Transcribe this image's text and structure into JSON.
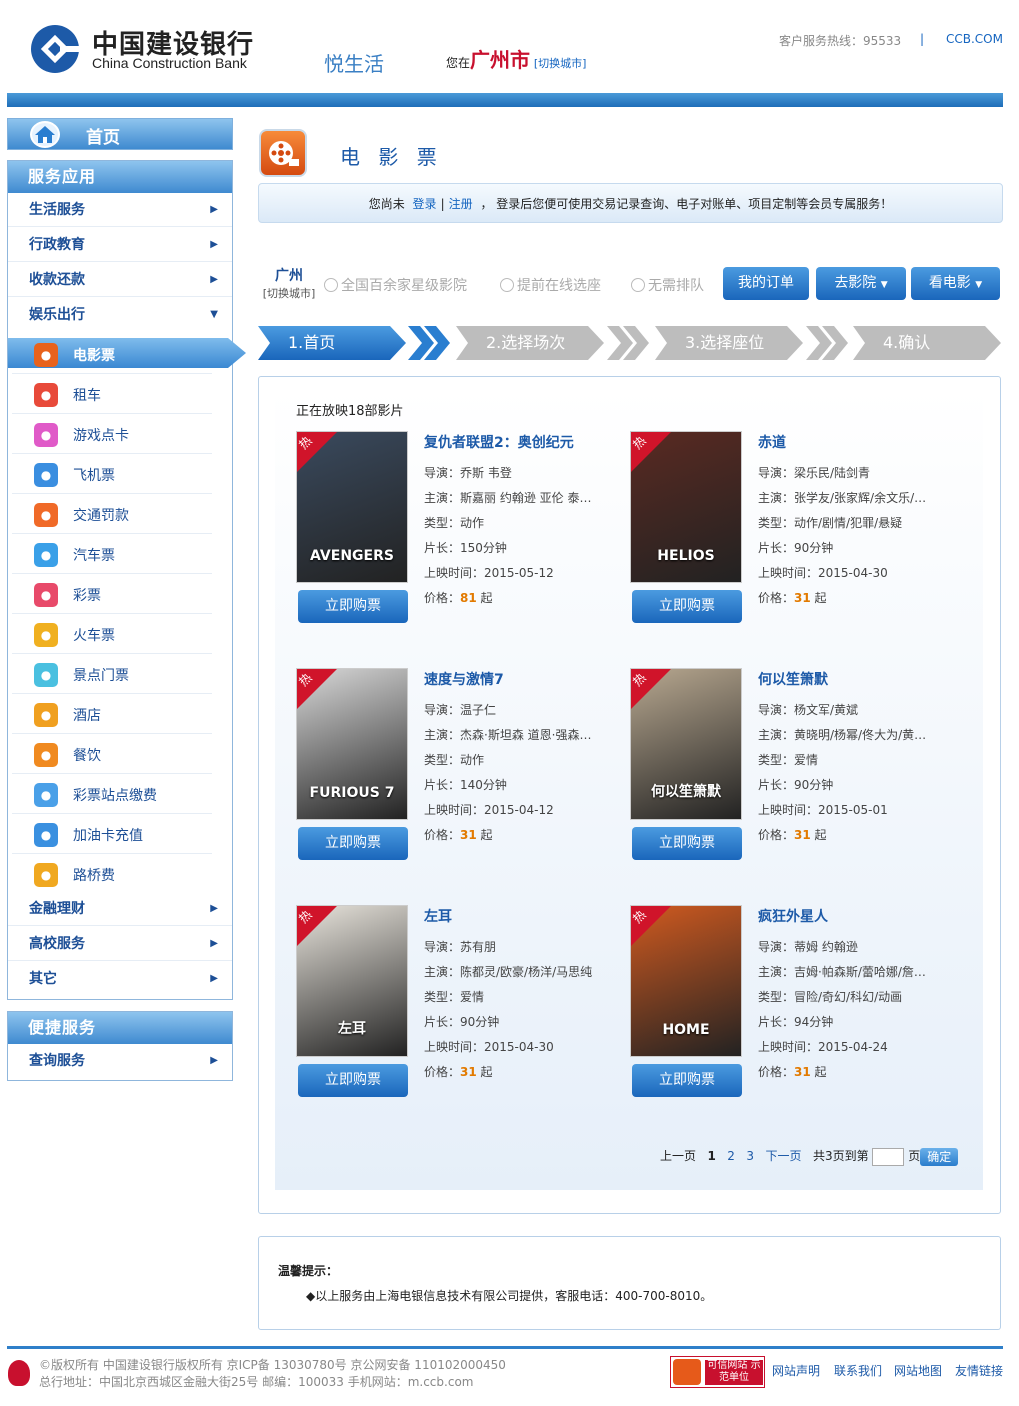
{
  "header": {
    "bank_name_cn": "中国建设银行",
    "bank_name_en": "China Construction Bank",
    "brand": "悦生活",
    "location_prefix": "您在",
    "city": "广州市",
    "switch_city": "[切换城市]",
    "hotline": "客户服务热线：95533",
    "separator": "|",
    "site_link": "CCB.COM"
  },
  "sidebar": {
    "home_label": "首页",
    "service_head": "服务应用",
    "categories": [
      {
        "label": "生活服务"
      },
      {
        "label": "行政教育"
      },
      {
        "label": "收款还款"
      },
      {
        "label": "娱乐出行"
      }
    ],
    "items": [
      {
        "label": "电影票",
        "icon": "film-icon",
        "color": "#e8621c"
      },
      {
        "label": "租车",
        "icon": "car-rental-icon",
        "color": "#e84a3a"
      },
      {
        "label": "游戏点卡",
        "icon": "gamepad-icon",
        "color": "#e05ac8"
      },
      {
        "label": "飞机票",
        "icon": "airplane-icon",
        "color": "#3a8ee0"
      },
      {
        "label": "交通罚款",
        "icon": "traffic-fine-icon",
        "color": "#f06a28"
      },
      {
        "label": "汽车票",
        "icon": "bus-icon",
        "color": "#3aa0e8"
      },
      {
        "label": "彩票",
        "icon": "lottery-star-icon",
        "color": "#e84a6a"
      },
      {
        "label": "火车票",
        "icon": "train-icon",
        "color": "#f0b020"
      },
      {
        "label": "景点门票",
        "icon": "scenic-ticket-icon",
        "color": "#4ac0e0"
      },
      {
        "label": "酒店",
        "icon": "hotel-icon",
        "color": "#f0a020"
      },
      {
        "label": "餐饮",
        "icon": "dining-icon",
        "color": "#f08a20"
      },
      {
        "label": "彩票站点缴费",
        "icon": "lottery-station-icon",
        "color": "#4aa0e8"
      },
      {
        "label": "加油卡充值",
        "icon": "fuel-card-icon",
        "color": "#3a90e0"
      },
      {
        "label": "路桥费",
        "icon": "toll-icon",
        "color": "#f0a820"
      }
    ],
    "more_categories": [
      {
        "label": "金融理财"
      },
      {
        "label": "高校服务"
      },
      {
        "label": "其它"
      }
    ],
    "convenience_head": "便捷服务",
    "convenience_items": [
      {
        "label": "查询服务"
      }
    ]
  },
  "main": {
    "title": "电 影 票",
    "notice": {
      "prefix": "您尚未",
      "login": "登录",
      "sep": "|",
      "register": "注册",
      "suffix": "，  登录后您便可使用交易记录查询、电子对账单、项目定制等会员专属服务！"
    },
    "city": "广州",
    "city_switch": "[切换城市]",
    "features": [
      "全国百余家星级影院",
      "提前在线选座",
      "无需排队"
    ],
    "buttons": {
      "my_orders": "我的订单",
      "go_cinema": "去影院",
      "watch_movie": "看电影"
    },
    "steps": [
      "1.首页",
      "2.选择场次",
      "3.选择座位",
      "4.确认"
    ],
    "count_text": "正在放映18部影片",
    "hot_badge": "热",
    "buy_label": "立即购票",
    "price_suffix": "起",
    "movies": [
      {
        "title": "复仇者联盟2：奥创纪元",
        "director": "导演：乔斯 韦登",
        "cast": "主演：斯嘉丽 约翰逊 亚伦 泰勒-约翰逊",
        "genre": "类型：动作",
        "length": "片长：150分钟",
        "release": "上映时间：2015-05-12",
        "price_prefix": "价格：",
        "price": "81"
      },
      {
        "title": "赤道",
        "director": "导演：梁乐民/陆剑青",
        "cast": "主演：张学友/张家辉/余文乐/林嘉欣",
        "genre": "类型：动作/剧情/犯罪/悬疑",
        "length": "片长：90分钟",
        "release": "上映时间：2015-04-30",
        "price_prefix": "价格：",
        "price": "31"
      },
      {
        "title": "速度与激情7",
        "director": "导演：温子仁",
        "cast": "主演：杰森·斯坦森 道恩·强森 范·迪塞尔",
        "genre": "类型：动作",
        "length": "片长：140分钟",
        "release": "上映时间：2015-04-12",
        "price_prefix": "价格：",
        "price": "31"
      },
      {
        "title": "何以笙箫默",
        "director": "导演：杨文军/黄斌",
        "cast": "主演：黄晓明/杨幂/佟大为/黄子佼",
        "genre": "类型：爱情",
        "length": "片长：90分钟",
        "release": "上映时间：2015-05-01",
        "price_prefix": "价格：",
        "price": "31"
      },
      {
        "title": "左耳",
        "director": "导演：苏有朋",
        "cast": "主演：陈都灵/欧豪/杨洋/马思纯",
        "genre": "类型：爱情",
        "length": "片长：90分钟",
        "release": "上映时间：2015-04-30",
        "price_prefix": "价格：",
        "price": "31"
      },
      {
        "title": "疯狂外星人",
        "director": "导演：蒂姆 约翰逊",
        "cast": "主演：吉姆·帕森斯/蕾哈娜/詹妮弗·洛佩兹",
        "genre": "类型：冒险/奇幻/科幻/动画",
        "length": "片长：94分钟",
        "release": "上映时间：2015-04-24",
        "price_prefix": "价格：",
        "price": "31"
      }
    ],
    "poster_colors": [
      "#3a4a5e",
      "#5a2a22",
      "#d8d8d8",
      "#b8a890",
      "#e8e4dc",
      "#d05a20"
    ],
    "poster_texts": [
      "AVENGERS",
      "HELIOS",
      "FURIOUS 7",
      "何以笙箫默",
      "左耳",
      "HOME"
    ],
    "pager": {
      "prev": "上一页",
      "pages": [
        "1",
        "2",
        "3"
      ],
      "next": "下一页",
      "total": "共3页到第",
      "page_unit": "页",
      "ok": "确定"
    }
  },
  "tip": {
    "title": "温馨提示：",
    "text": "◆以上服务由上海电银信息技术有限公司提供，客服电话：400-700-8010。"
  },
  "footer": {
    "copyright": "©版权所有 中国建设银行版权所有 京ICP备 13030780号 京公网安备 110102000450",
    "address": "总行地址：中国北京西城区金融大街25号       邮编：100033       手机网站：m.ccb.com",
    "trust_badge": "可信网站 示范单位",
    "links": [
      "网站声明",
      "联系我们",
      "网站地图",
      "友情链接"
    ]
  }
}
